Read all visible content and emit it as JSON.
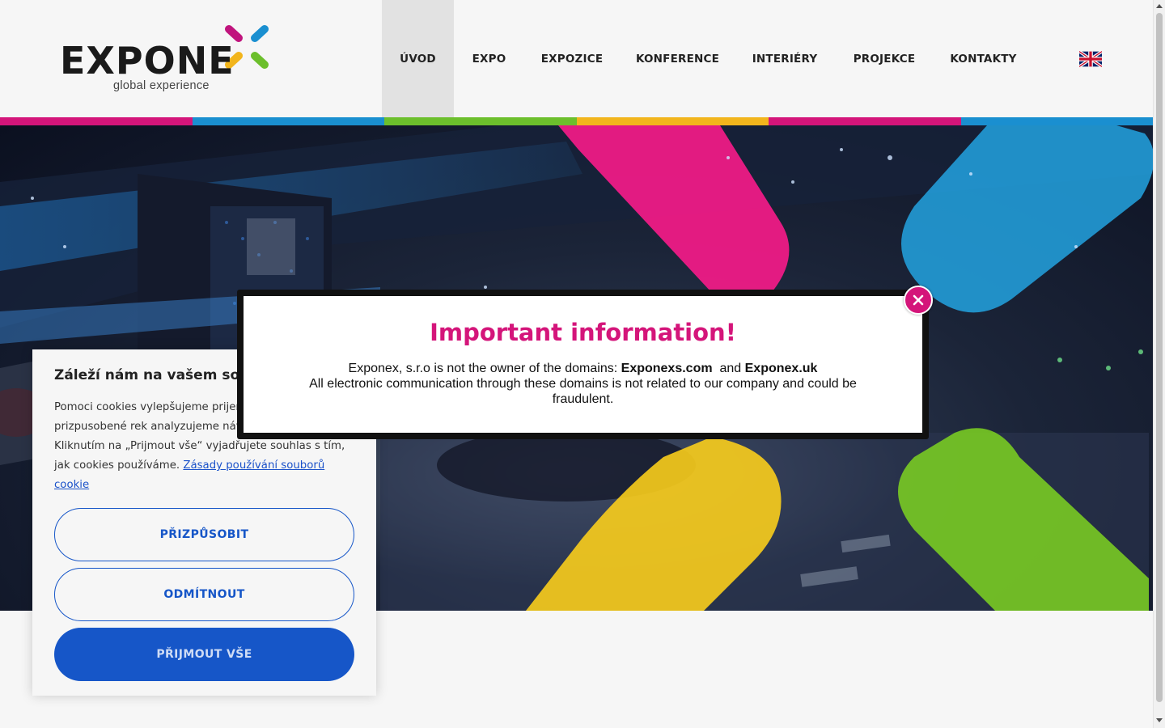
{
  "brand": {
    "name": "EXPONE",
    "tagline": "global experience",
    "colors": {
      "magenta": "#d4157a",
      "blue": "#1a8fd0",
      "green": "#6cbf2c",
      "yellow": "#f2b51c"
    }
  },
  "nav": {
    "items": [
      {
        "label": "ÚVOD",
        "active": true
      },
      {
        "label": "EXPO"
      },
      {
        "label": "EXPOZICE"
      },
      {
        "label": "KONFERENCE"
      },
      {
        "label": "INTERIÉRY"
      },
      {
        "label": "PROJEKCE"
      },
      {
        "label": "KONTAKTY"
      }
    ],
    "language_icon": "uk-flag-icon"
  },
  "stripes": [
    "#d4157a",
    "#1a8fd0",
    "#6cbf2c",
    "#f2b51c",
    "#d4157a",
    "#1a8fd0"
  ],
  "hero": {
    "shape_colors": [
      "#ff1a8c",
      "#23a8e8",
      "#ffd21a",
      "#7ed321"
    ]
  },
  "modal": {
    "title": "Important information!",
    "line1_prefix": "Exponex, s.r.o is not the owner of the domains:",
    "domain1": "Exponexs.com",
    "line1_and": "and",
    "domain2": "Exponex.uk",
    "line2": "All electronic communication through these domains is not related to our company and could be",
    "line3": "fraudulent.",
    "close_icon": "close-icon"
  },
  "cookie": {
    "title": "Záleží nám na vašem souk",
    "text": "Pomoci cookies vylepšujeme prijem nabizíme na miru prizpusobené rek analyzujeme návštěvnost stránky. Kliknutím na „Prijmout vše“ vyjadřujete souhlas s tím, jak cookies používáme.",
    "link": "Zásady používání souborů cookie",
    "buttons": {
      "customize": "PŘIZPŮSOBIT",
      "reject": "ODMÍTNOUT",
      "accept": "PŘIJMOUT VŠE"
    }
  }
}
